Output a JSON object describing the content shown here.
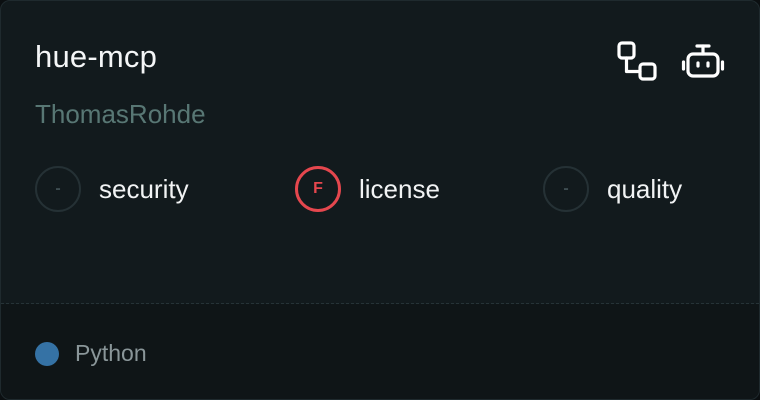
{
  "card": {
    "title": "hue-mcp",
    "author": "ThomasRohde",
    "icons": [
      "flow-icon",
      "robot-icon"
    ],
    "scores": [
      {
        "label": "security",
        "grade": "-",
        "status": "none"
      },
      {
        "label": "license",
        "grade": "F",
        "status": "fail"
      },
      {
        "label": "quality",
        "grade": "-",
        "status": "none"
      }
    ],
    "language": {
      "name": "Python",
      "color": "#3572a5"
    }
  },
  "colors": {
    "background": "#121a1d",
    "footer": "#0f1517",
    "fail": "#e5474e",
    "author": "#587774"
  }
}
